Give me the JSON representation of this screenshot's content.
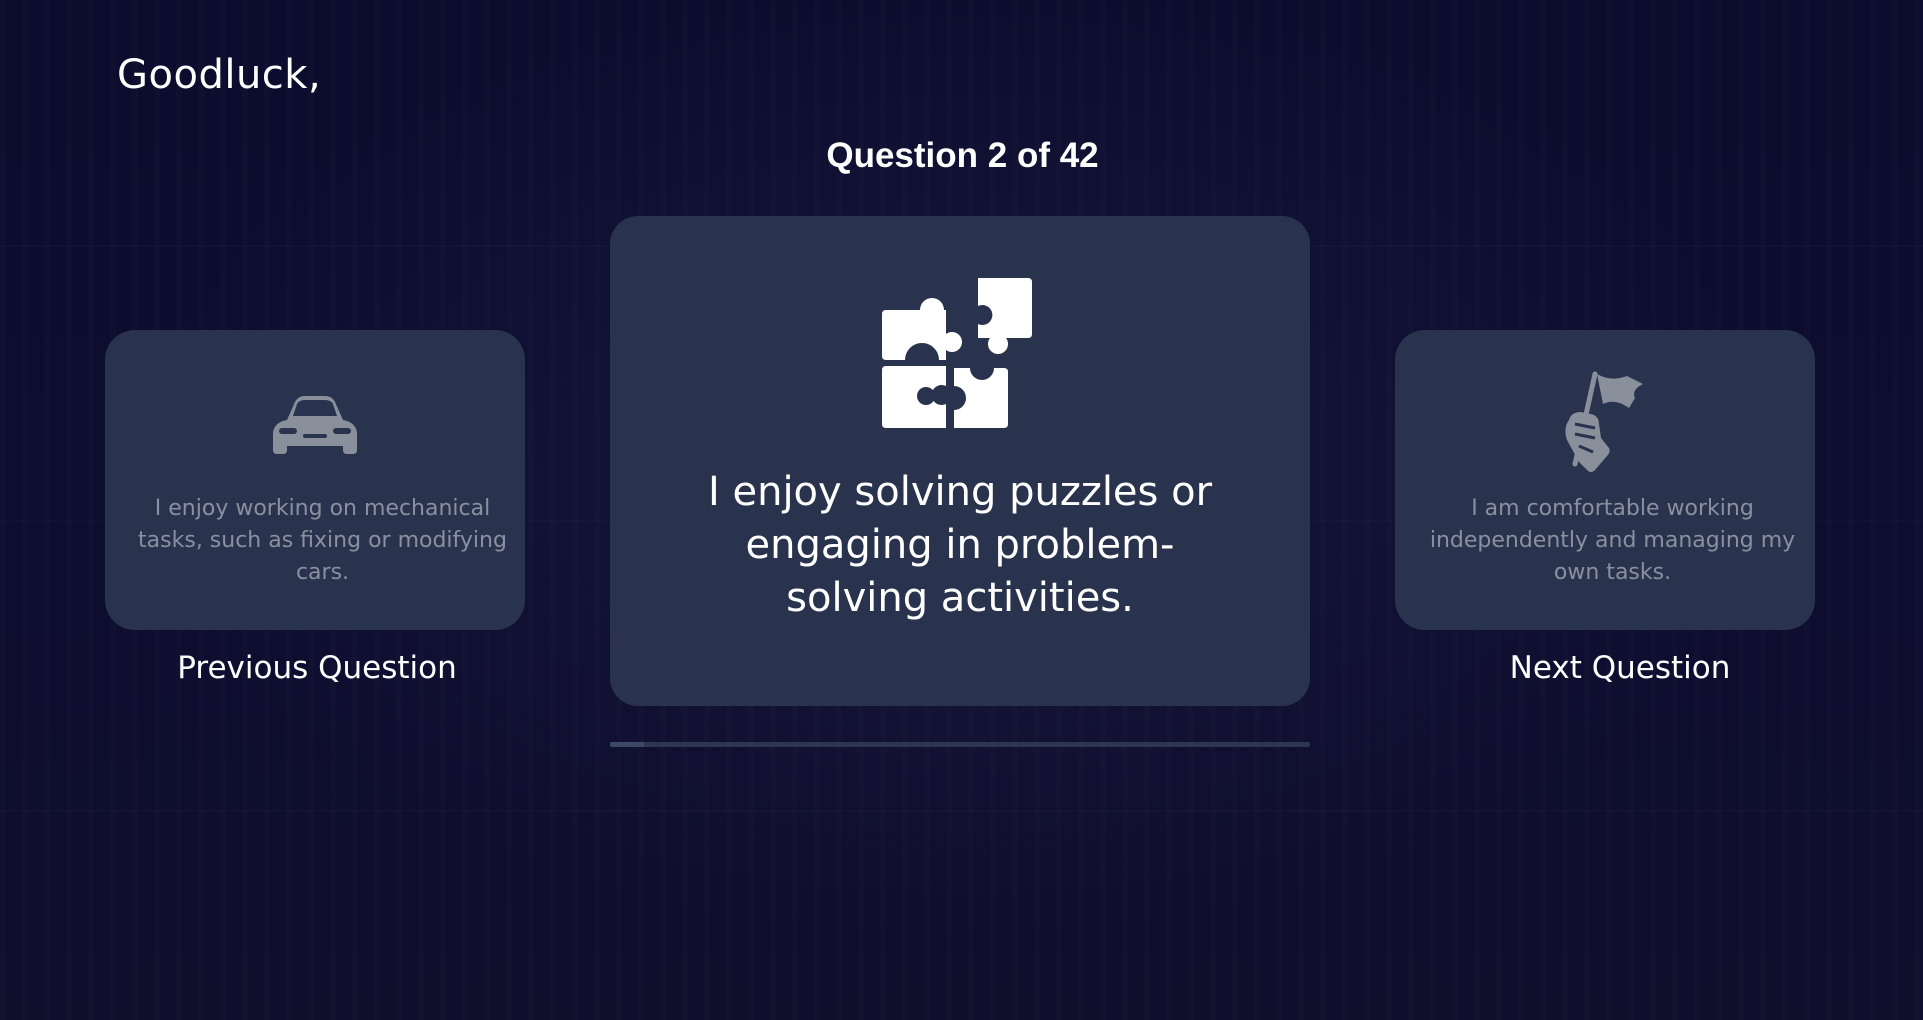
{
  "header": {
    "greeting": "Goodluck,"
  },
  "quiz": {
    "counter": "Question 2 of 42",
    "current_question": 2,
    "total_questions": 42,
    "progress_fraction": 0.048
  },
  "previous": {
    "icon": "car-icon",
    "text": "I enjoy working on mechanical tasks, such as fixing or modifying cars.",
    "label": "Previous Question"
  },
  "current": {
    "icon": "puzzle-icon",
    "text": "I enjoy solving puzzles or engaging in problem-solving activities."
  },
  "next": {
    "icon": "hand-flag-icon",
    "text": "I am comfortable working independently and managing my own tasks.",
    "label": "Next Question"
  },
  "colors": {
    "background": "#0b0b2a",
    "card": "#29334d",
    "side_text": "#8a90a0",
    "side_icon": "#8a8f9c",
    "text": "#ffffff"
  }
}
